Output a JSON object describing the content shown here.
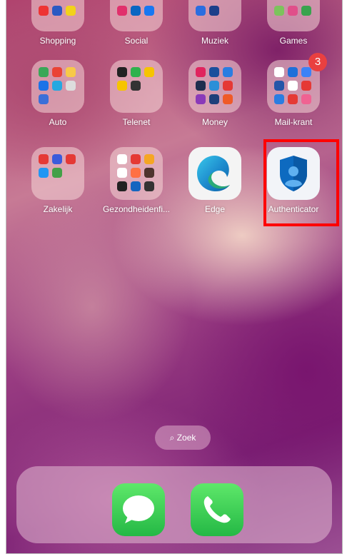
{
  "row1": [
    {
      "label": "Shopping"
    },
    {
      "label": "Social"
    },
    {
      "label": "Muziek"
    },
    {
      "label": "Games"
    }
  ],
  "row2": [
    {
      "label": "Auto"
    },
    {
      "label": "Telenet"
    },
    {
      "label": "Money"
    },
    {
      "label": "Mail-krant",
      "badge": "3"
    }
  ],
  "row3": [
    {
      "label": "Zakelijk"
    },
    {
      "label": "Gezondheidenfi..."
    },
    {
      "label": "Edge"
    },
    {
      "label": "Authenticator"
    }
  ],
  "search": {
    "label": "Zoek"
  },
  "colors": {
    "highlight": "#ff0000",
    "badge": "#e94040",
    "edge": "#1f8ecf",
    "authenticator": "#0d6ac0",
    "phone_green": "#34c759"
  },
  "icons": {
    "search": "magnifier-icon",
    "dock1": "messages-icon",
    "dock2": "phone-icon"
  }
}
